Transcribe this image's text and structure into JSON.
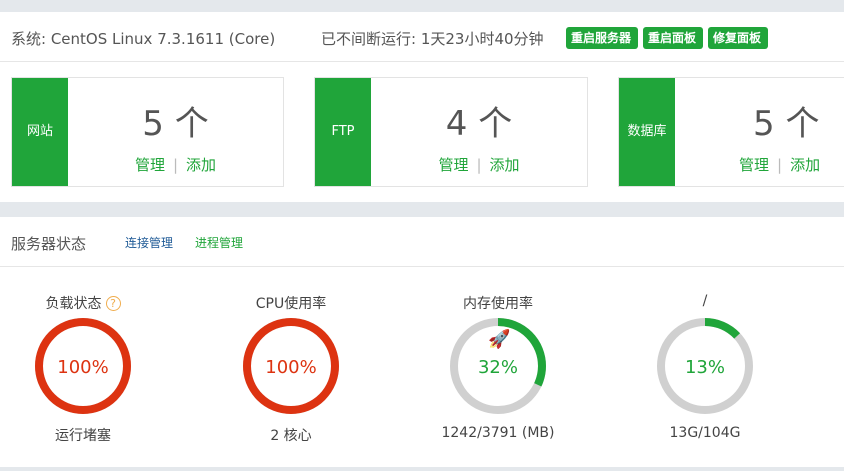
{
  "system": {
    "os_text": "系统: CentOS Linux 7.3.1611 (Core)",
    "uptime_text": "已不间断运行: 1天23小时40分钟",
    "buttons": {
      "restart_server": "重启服务器",
      "restart_panel": "重启面板",
      "repair_panel": "修复面板"
    }
  },
  "cards": [
    {
      "label": "网站",
      "count": "5 个",
      "manage": "管理",
      "add": "添加"
    },
    {
      "label": "FTP",
      "count": "4 个",
      "manage": "管理",
      "add": "添加"
    },
    {
      "label": "数据库",
      "count": "5 个",
      "manage": "管理",
      "add": "添加"
    }
  ],
  "link_separator": "|",
  "status": {
    "title": "服务器状态",
    "tabs": {
      "connections": "连接管理",
      "processes": "进程管理"
    },
    "gauges": [
      {
        "title": "负载状态",
        "value": "100%",
        "percent": 100,
        "color": "#dd3311",
        "detail": "运行堵塞",
        "icon": "help-icon"
      },
      {
        "title": "CPU使用率",
        "value": "100%",
        "percent": 100,
        "color": "#dd3311",
        "detail": "2 核心"
      },
      {
        "title": "内存使用率",
        "value": "32%",
        "percent": 32,
        "color": "#20a53a",
        "detail": "1242/3791 (MB)",
        "icon": "rocket-icon"
      },
      {
        "title": "/",
        "value": "13%",
        "percent": 13,
        "color": "#20a53a",
        "detail": "13G/104G"
      }
    ]
  },
  "colors": {
    "accent": "#20a53a",
    "danger": "#dd3311",
    "track": "#d0d0d0"
  }
}
